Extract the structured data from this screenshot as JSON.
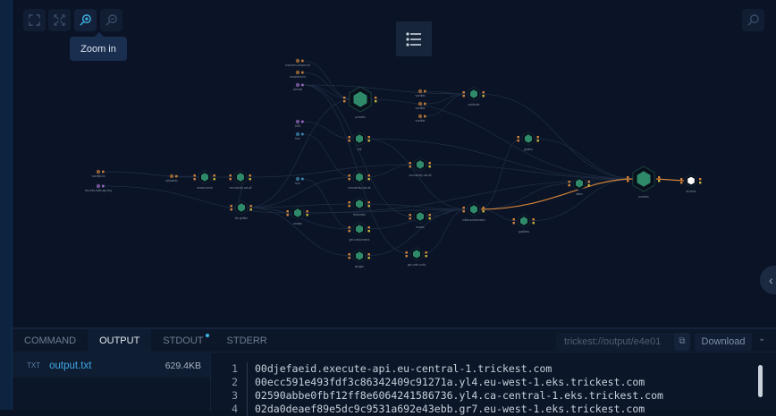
{
  "toolbar": {
    "fit_label": "Fit view",
    "fullscreen_label": "Fullscreen",
    "zoom_in_tooltip": "Zoom in"
  },
  "accent": "#3fb4e6",
  "workflow": {
    "nodes": [
      {
        "label": "resolvers-trusted.txt",
        "kind": "input",
        "color": "#c27c3a"
      },
      {
        "label": "resolvers.txt",
        "kind": "input",
        "color": "#c27c3a"
      },
      {
        "label": "domain",
        "kind": "input",
        "color": "#9a6bc2"
      },
      {
        "label": "ASN",
        "kind": "input",
        "color": "#9a6bc2"
      },
      {
        "label": "true",
        "kind": "input",
        "color": "#3e8bb5"
      },
      {
        "label": "wordlist.txt",
        "kind": "input",
        "color": "#c27c3a"
      },
      {
        "label": "security-trails-api-key",
        "kind": "input",
        "color": "#9a6bc2"
      },
      {
        "label": "wildcards",
        "kind": "input",
        "color": "#c27c3a"
      },
      {
        "label": "wordlist",
        "kind": "input",
        "color": "#c27c3a"
      },
      {
        "label": "wordlist",
        "kind": "input",
        "color": "#c27c3a"
      },
      {
        "label": "wordlist",
        "kind": "input",
        "color": "#c27c3a"
      },
      {
        "label": "true",
        "kind": "input",
        "color": "#3e8bb5"
      },
      {
        "label": "puredns",
        "kind": "tool-big"
      },
      {
        "label": "subfinder",
        "kind": "tool"
      },
      {
        "label": "cidr",
        "kind": "tool"
      },
      {
        "label": "amass-brute",
        "kind": "tool"
      },
      {
        "label": "recursively-cat-all",
        "kind": "tool"
      },
      {
        "label": "file-splitter",
        "kind": "tool"
      },
      {
        "label": "amass",
        "kind": "tool"
      },
      {
        "label": "recursively-cat-all",
        "kind": "tool"
      },
      {
        "label": "findomain",
        "kind": "tool"
      },
      {
        "label": "get-subdomains",
        "kind": "tool"
      },
      {
        "label": "dnsgen",
        "kind": "tool"
      },
      {
        "label": "recursively-cat-all",
        "kind": "tool"
      },
      {
        "label": "amass",
        "kind": "tool"
      },
      {
        "label": "initial-subdomains",
        "kind": "tool"
      },
      {
        "label": "get-crtsh-subs",
        "kind": "tool"
      },
      {
        "label": "gotator",
        "kind": "tool"
      },
      {
        "label": "alterx",
        "kind": "tool"
      },
      {
        "label": "goaltdns",
        "kind": "tool"
      },
      {
        "label": "puredns",
        "kind": "tool-big"
      },
      {
        "label": "all-subs",
        "kind": "output"
      }
    ]
  },
  "panel": {
    "tabs": [
      {
        "label": "COMMAND"
      },
      {
        "label": "OUTPUT",
        "active": true
      },
      {
        "label": "STDOUT",
        "dot": true
      },
      {
        "label": "STDERR"
      }
    ],
    "output_path": "trickest://output/e4e01",
    "download_label": "Download",
    "files": [
      {
        "type": "TXT",
        "name": "output.txt",
        "size": "629.4KB"
      }
    ],
    "lines": [
      {
        "n": "1",
        "text": "00djefaeid.execute-api.eu-central-1.trickest.com"
      },
      {
        "n": "2",
        "text": "00ecc591e493fdf3c86342409c91271a.yl4.eu-west-1.eks.trickest.com"
      },
      {
        "n": "3",
        "text": "02590abbe0fbf12ff8e6064241586736.yl4.ca-central-1.eks.trickest.com"
      },
      {
        "n": "4",
        "text": "02da0deaef89e5dc9c9531a692e43ebb.gr7.eu-west-1.eks.trickest.com"
      }
    ]
  }
}
